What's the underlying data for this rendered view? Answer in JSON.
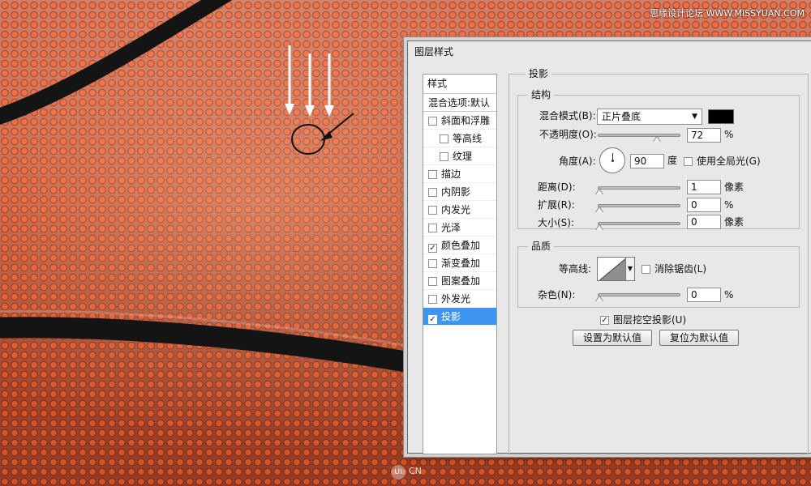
{
  "watermark": "思缘设计论坛 WWW.MISSYUAN.COM",
  "bottom_logo": {
    "badge": "UI",
    "text": "CN"
  },
  "dialog": {
    "title": "图层样式",
    "left_pane": {
      "title": "样式",
      "items": [
        {
          "label": "混合选项:默认",
          "checked": null
        },
        {
          "label": "斜面和浮雕",
          "checked": false
        },
        {
          "label": "等高线",
          "checked": false
        },
        {
          "label": "纹理",
          "checked": false
        },
        {
          "label": "描边",
          "checked": false
        },
        {
          "label": "内阴影",
          "checked": false
        },
        {
          "label": "内发光",
          "checked": false
        },
        {
          "label": "光泽",
          "checked": false
        },
        {
          "label": "颜色叠加",
          "checked": true
        },
        {
          "label": "渐变叠加",
          "checked": false
        },
        {
          "label": "图案叠加",
          "checked": false
        },
        {
          "label": "外发光",
          "checked": false
        },
        {
          "label": "投影",
          "checked": true,
          "selected": true
        }
      ]
    },
    "section_title": "投影",
    "structure": {
      "title": "结构",
      "blend_mode_label": "混合模式(B):",
      "blend_mode_value": "正片叠底",
      "blend_color": "#000000",
      "opacity_label": "不透明度(O):",
      "opacity_value": "72",
      "opacity_unit": "%",
      "opacity_fraction": 0.72,
      "angle_label": "角度(A):",
      "angle_value": "90",
      "angle_unit": "度",
      "global_light_label": "使用全局光(G)",
      "global_light_checked": false,
      "distance_label": "距离(D):",
      "distance_value": "1",
      "distance_unit": "像素",
      "spread_label": "扩展(R):",
      "spread_value": "0",
      "spread_unit": "%",
      "size_label": "大小(S):",
      "size_value": "0",
      "size_unit": "像素"
    },
    "quality": {
      "title": "品质",
      "contour_label": "等高线:",
      "antialias_label": "消除锯齿(L)",
      "antialias_checked": false,
      "noise_label": "杂色(N):",
      "noise_value": "0",
      "noise_unit": "%"
    },
    "knockout_label": "图层挖空投影(U)",
    "knockout_checked": true,
    "set_default_button": "设置为默认值",
    "reset_default_button": "复位为默认值"
  }
}
